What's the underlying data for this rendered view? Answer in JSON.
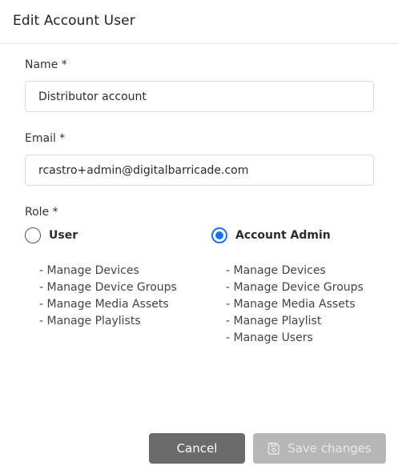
{
  "dialog": {
    "title": "Edit Account User"
  },
  "form": {
    "name_label": "Name *",
    "name_value": "Distributor account",
    "email_label": "Email *",
    "email_value": "rcastro+admin@digitalbarricade.com",
    "role_label": "Role *"
  },
  "roles": [
    {
      "label": "User",
      "selected": false,
      "permissions": [
        "- Manage Devices",
        "- Manage Device Groups",
        "- Manage Media Assets",
        "- Manage Playlists"
      ]
    },
    {
      "label": "Account Admin",
      "selected": true,
      "permissions": [
        "- Manage Devices",
        "- Manage Device Groups",
        "- Manage Media Assets",
        "- Manage Playlist",
        "- Manage Users"
      ]
    }
  ],
  "actions": {
    "cancel_label": "Cancel",
    "save_label": "Save changes",
    "save_icon": "save-icon"
  },
  "colors": {
    "accent": "#1a73e8",
    "cancel_bg": "#6b6b6b",
    "save_disabled_bg": "#b7b7b7"
  }
}
